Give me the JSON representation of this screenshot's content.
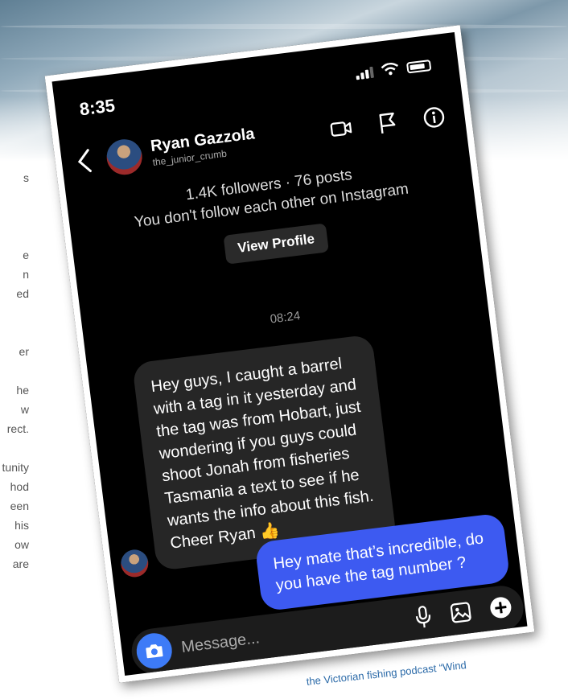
{
  "status_bar": {
    "time": "8:35"
  },
  "header": {
    "name": "Ryan Gazzola",
    "handle": "the_junior_crumb"
  },
  "profile": {
    "stats": "1.4K followers · 76 posts",
    "follow_note": "You don't follow each other on Instagram",
    "view_profile_label": "View Profile"
  },
  "conversation": {
    "timestamp": "08:24",
    "incoming": "Hey guys, I caught a barrel with a tag in it yesterday and the tag was from Hobart, just wondering if you guys could shoot Jonah from fisheries Tasmania a text to see if he wants the info about this fish. Cheer Ryan 👍",
    "outgoing": "Hey mate that’s incredible, do you have the tag number ?"
  },
  "composer": {
    "placeholder": "Message..."
  },
  "page": {
    "side_text": [
      "s",
      "",
      "",
      "",
      "e",
      "n",
      "ed",
      "",
      "",
      "er",
      "",
      "he",
      "w",
      "rect.",
      "",
      "tunity",
      "hod",
      "een",
      "his",
      "ow",
      "are"
    ],
    "caption": "the Victorian fishing podcast “Wind"
  },
  "icons": {
    "back": "chevron-left-icon",
    "video": "video-camera-icon",
    "flag": "flag-icon",
    "info": "info-icon",
    "camera": "camera-icon",
    "mic": "microphone-icon",
    "gallery": "image-icon",
    "add": "plus-icon"
  },
  "colors": {
    "outgoing_bubble": "#3d5af1",
    "incoming_bubble": "#262626",
    "camera_button": "#3d7bf7",
    "background": "#000000"
  }
}
